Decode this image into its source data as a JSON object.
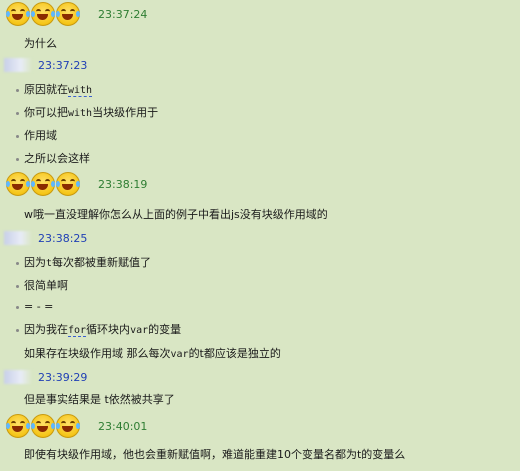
{
  "blocks": [
    {
      "type": "emoji-header",
      "time": "23:37:24"
    },
    {
      "type": "msg",
      "bullet": false,
      "text": "为什么"
    },
    {
      "type": "name-header",
      "time": "23:37:23"
    },
    {
      "type": "msg",
      "bullet": true,
      "parts": [
        "原因就在",
        "with",
        ""
      ]
    },
    {
      "type": "msg",
      "bullet": true,
      "parts": [
        "你可以把",
        "with",
        "当块级作用于"
      ]
    },
    {
      "type": "msg",
      "bullet": true,
      "text": "作用域"
    },
    {
      "type": "msg",
      "bullet": true,
      "text": "之所以会这样"
    },
    {
      "type": "emoji-header",
      "time": "23:38:19"
    },
    {
      "type": "msg",
      "bullet": false,
      "text": "w哦一直没理解你怎么从上面的例子中看出js没有块级作用域的"
    },
    {
      "type": "name-header",
      "time": "23:38:25"
    },
    {
      "type": "msg",
      "bullet": true,
      "parts": [
        "因为",
        "t",
        "每次都被重新赋值了"
      ]
    },
    {
      "type": "msg",
      "bullet": true,
      "text": "很简单啊"
    },
    {
      "type": "msg",
      "bullet": true,
      "text": "= - ="
    },
    {
      "type": "msg",
      "bullet": true,
      "parts": [
        "因为我在",
        "for",
        "循环块内",
        "var",
        "的变量"
      ]
    },
    {
      "type": "msg",
      "bullet": false,
      "parts": [
        "如果存在块级作用域     那么每次",
        "var",
        "的t都应该是独立的"
      ]
    },
    {
      "type": "name-header",
      "time": "23:39:29"
    },
    {
      "type": "msg",
      "bullet": false,
      "text": "但是事实结果是    t依然被共享了"
    },
    {
      "type": "emoji-header",
      "time": "23:40:01"
    },
    {
      "type": "msg",
      "bullet": false,
      "text": "即使有块级作用域，他也会重新赋值啊，难道能重建10个变量名都为t的变量么"
    }
  ]
}
